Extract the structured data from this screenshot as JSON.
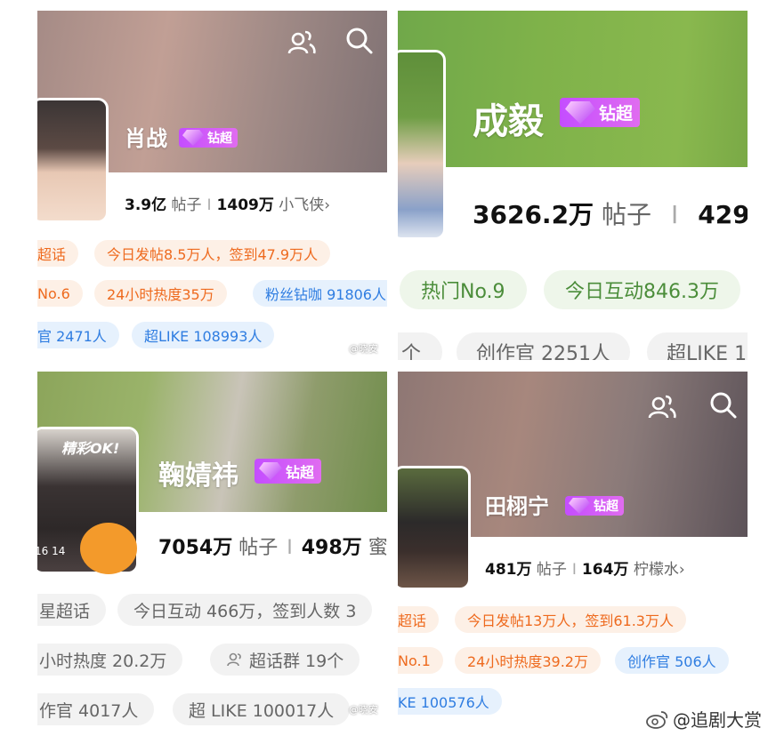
{
  "panels": {
    "p1": {
      "name": "肖战",
      "badge": "钻超",
      "stats": {
        "posts_value": "3.9亿",
        "posts_label": "帖子",
        "fans_value": "1409万",
        "fans_label": "小飞侠›"
      },
      "row1": [
        "超话",
        "今日发帖8.5万人，签到47.9万人"
      ],
      "row2": [
        "No.6",
        "24小时热度35万",
        "粉丝钻咖 91806人"
      ],
      "row3": [
        "官 2471人",
        "超LIKE 108993人"
      ],
      "watermark": "@晓安"
    },
    "p2": {
      "name": "成毅",
      "badge": "钻超",
      "stats": {
        "posts_value": "3626.2万",
        "posts_label": "帖子",
        "fans_value": "429."
      },
      "row1": [
        "热门No.9",
        "今日互动846.3万"
      ],
      "row2": [
        "个",
        "创作官 2251人",
        "超LIKE 1"
      ]
    },
    "p3": {
      "name": "鞠婧祎",
      "badge": "钻超",
      "avatar_text": "精彩OK!",
      "avatar_number": "16 14",
      "stats": {
        "posts_value": "7054万",
        "posts_label": "帖子",
        "fans_value": "498万",
        "fans_label": "蜜"
      },
      "row1": [
        "星超话",
        "今日互动 466万，签到人数 3"
      ],
      "row2": [
        "小时热度 20.2万",
        "超话群 19个"
      ],
      "row3": [
        "作官 4017人",
        "超 LIKE 100017人"
      ],
      "watermark": "@晓安"
    },
    "p4": {
      "name": "田栩宁",
      "badge": "钻超",
      "stats": {
        "posts_value": "481万",
        "posts_label": "帖子",
        "fans_value": "164万",
        "fans_label": "柠檬水›"
      },
      "row1": [
        "超话",
        "今日发帖13万人，签到61.3万人"
      ],
      "row2": [
        "No.1",
        "24小时热度39.2万",
        "创作官 506人"
      ],
      "row3": [
        "KE 100576人"
      ]
    }
  },
  "footer_watermark": "@追剧大赏",
  "colors": {
    "badge": "#c44dff",
    "orange": "#ee6a1e",
    "blue": "#2f7de1",
    "green_banner": "#7fb24a"
  },
  "icons": [
    "group-icon",
    "search-icon",
    "weibo-logo-icon"
  ]
}
